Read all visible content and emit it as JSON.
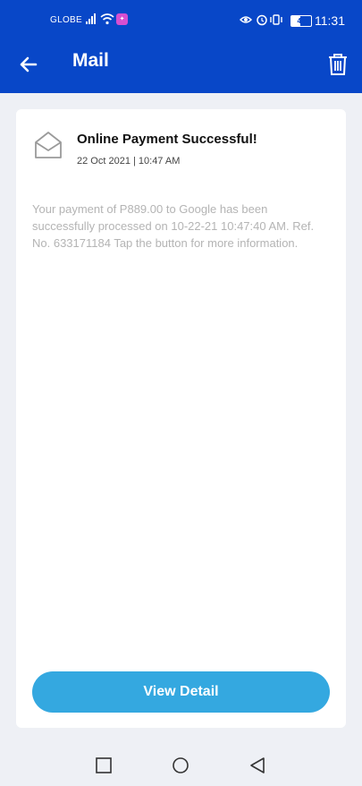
{
  "status_bar": {
    "carrier": "GLOBE",
    "battery": "45",
    "time": "11:31"
  },
  "header": {
    "title": "Mail"
  },
  "message": {
    "subject": "Online Payment Successful!",
    "datetime": "22 Oct 2021 | 10:47 AM",
    "body": "Your payment of P889.00 to Google has been successfully processed on 10-22-21 10:47:40 AM. Ref. No. 633171184 Tap the button for more information."
  },
  "actions": {
    "view_detail_label": "View Detail"
  },
  "icons": {
    "back": "arrow-left-icon",
    "delete": "trash-icon",
    "mail": "envelope-open-icon",
    "nav_recents": "square-icon",
    "nav_home": "circle-icon",
    "nav_back": "triangle-back-icon"
  },
  "colors": {
    "header_bg": "#0847c8",
    "button_bg": "#34a8e0",
    "page_bg": "#eef0f5"
  }
}
